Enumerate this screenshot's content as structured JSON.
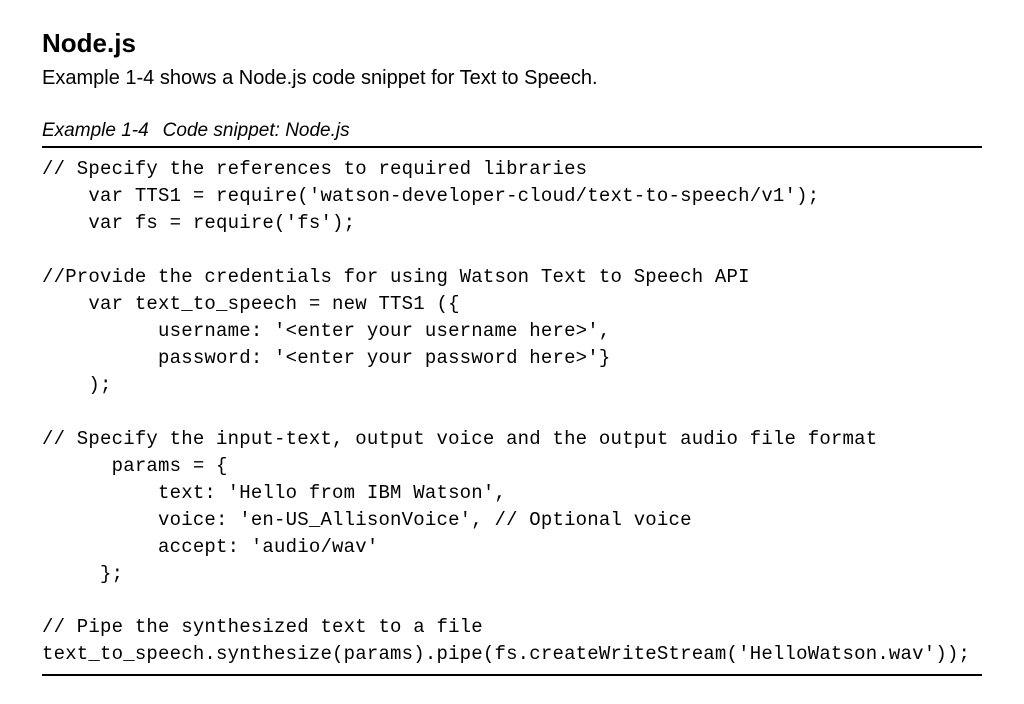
{
  "heading": "Node.js",
  "intro": "Example 1-4 shows a Node.js code snippet for Text to Speech.",
  "example_num": "Example 1-4",
  "example_title": "Code snippet: Node.js",
  "code": "// Specify the references to required libraries\n    var TTS1 = require('watson-developer-cloud/text-to-speech/v1');\n    var fs = require('fs');\n\n//Provide the credentials for using Watson Text to Speech API\n    var text_to_speech = new TTS1 ({\n          username: '<enter your username here>',\n          password: '<enter your password here>'}\n    );\n\n// Specify the input-text, output voice and the output audio file format\n      params = {\n          text: 'Hello from IBM Watson',\n          voice: 'en-US_AllisonVoice', // Optional voice\n          accept: 'audio/wav'\n     };\n\n// Pipe the synthesized text to a file\ntext_to_speech.synthesize(params).pipe(fs.createWriteStream('HelloWatson.wav'));"
}
